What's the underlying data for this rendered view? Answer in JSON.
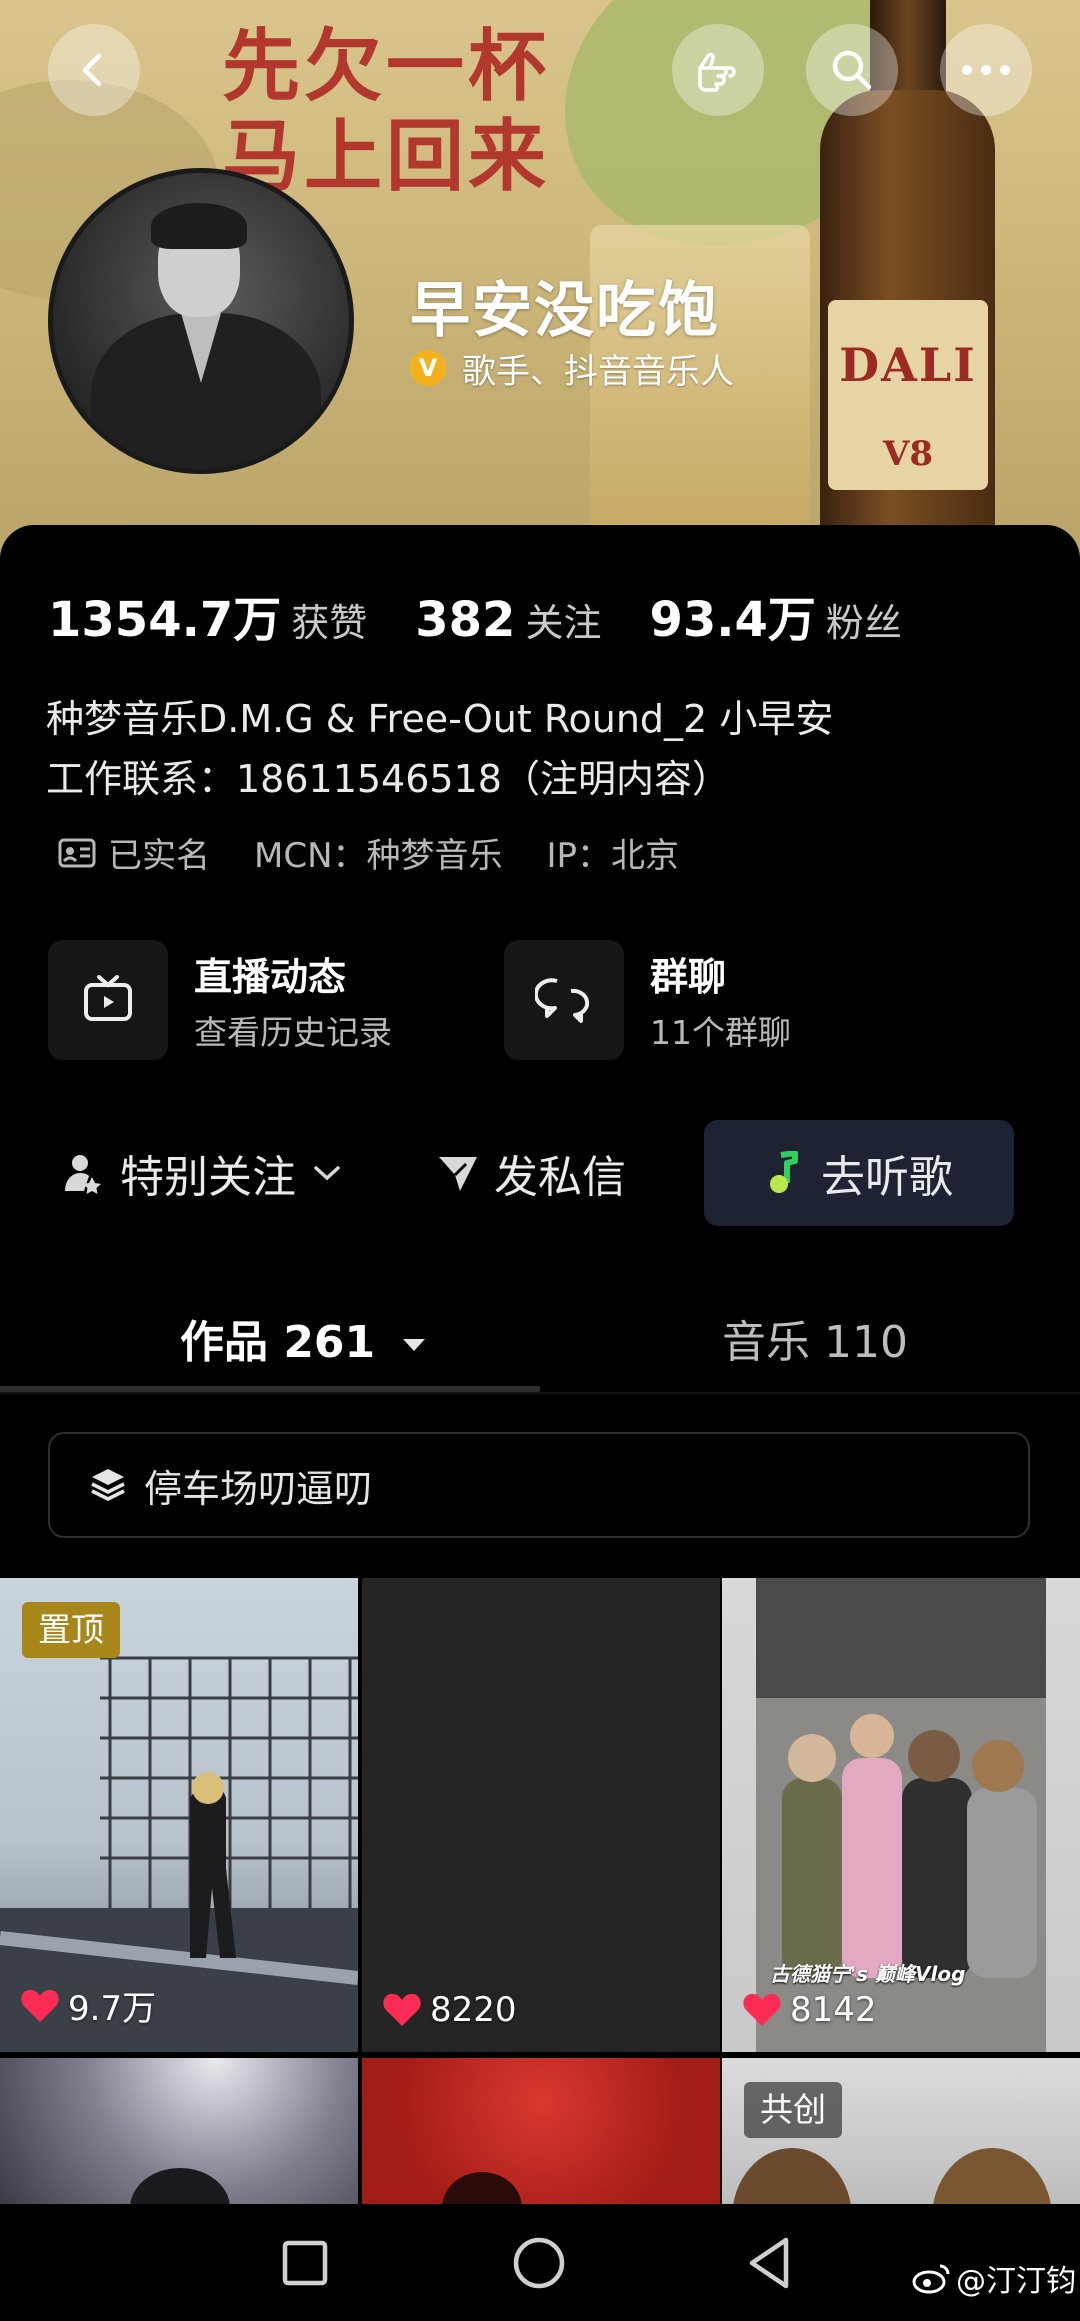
{
  "banner": {
    "ad_line1": "先欠一杯",
    "ad_line2": "马上回来",
    "bottle_brand": "DALI",
    "bottle_model": "V8",
    "icons": [
      "back-icon",
      "hand-point-icon",
      "search-icon",
      "more-icon"
    ]
  },
  "profile": {
    "name": "早安没吃饱",
    "badge": "V",
    "title": "歌手、抖音音乐人"
  },
  "stats": [
    {
      "value": "1354.7万",
      "label": "获赞"
    },
    {
      "value": "382",
      "label": "关注"
    },
    {
      "value": "93.4万",
      "label": "粉丝"
    }
  ],
  "bio": {
    "line1": "种梦音乐D.M.G & Free-Out  Round_2 小早安",
    "line2": "工作联系：18611546518（注明内容）"
  },
  "meta": {
    "verified": "已实名",
    "mcn": "MCN：种梦音乐",
    "ip": "IP：北京"
  },
  "tiles": [
    {
      "title": "直播动态",
      "sub": "查看历史记录",
      "icon": "tv-icon"
    },
    {
      "title": "群聊",
      "sub": "11个群聊",
      "icon": "chat-bubbles-icon"
    }
  ],
  "actions": {
    "follow": "特别关注",
    "message": "发私信",
    "listen": "去听歌"
  },
  "tabs": {
    "works": "作品 261",
    "music": "音乐 110"
  },
  "collection": {
    "label": "停车场叨逼叨"
  },
  "grid": [
    {
      "likes": "9.7万",
      "badge": "置顶"
    },
    {
      "likes": "8220"
    },
    {
      "likes": "8142",
      "caption": "古德猫宁's 巅峰Vlog"
    },
    {},
    {},
    {
      "badge": "共创"
    }
  ],
  "colors": {
    "accent_like": "#fe2c55",
    "listen_bg": "#1e2333",
    "pin_badge": "#a8871a",
    "verified_badge": "#f3b21b"
  },
  "watermark": "@汀汀钧"
}
